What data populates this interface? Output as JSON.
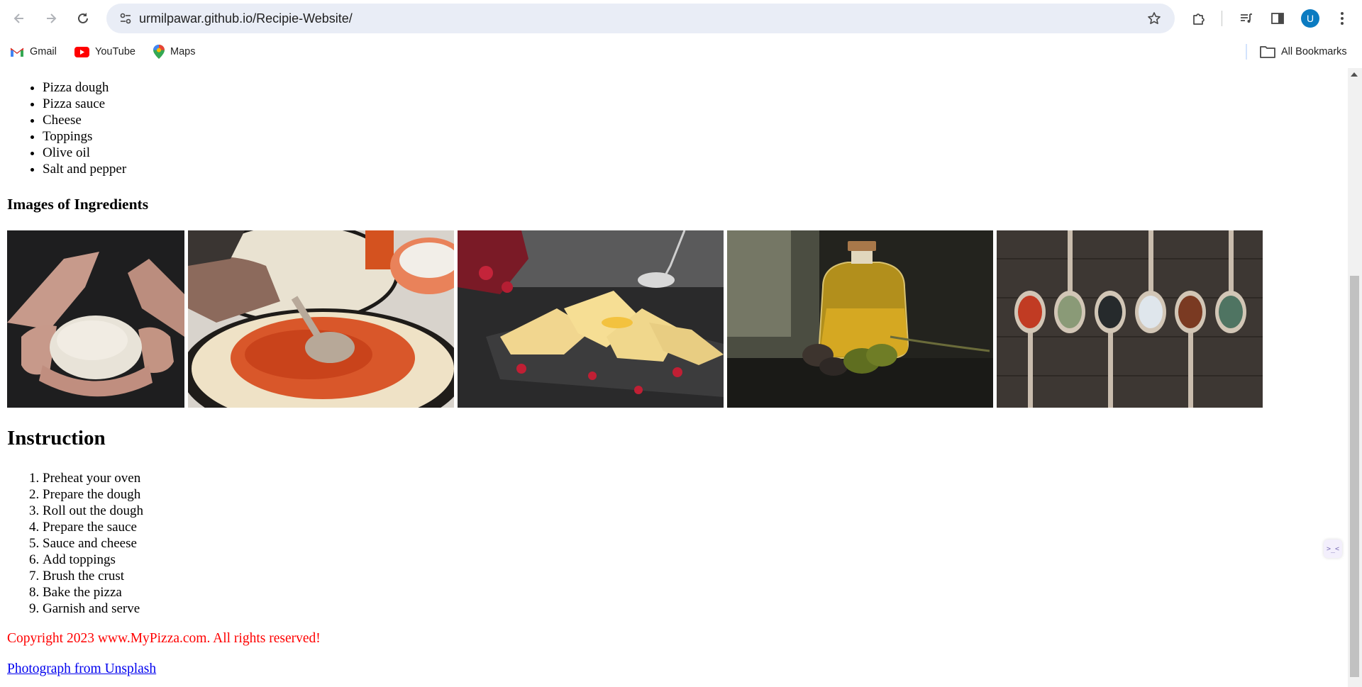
{
  "browser": {
    "url": "urmilpawar.github.io/Recipie-Website/",
    "avatar_letter": "U",
    "accent_color": "#0b7bc1",
    "bookmarks": [
      {
        "label": "Gmail",
        "icon": "gmail-icon"
      },
      {
        "label": "YouTube",
        "icon": "youtube-icon"
      },
      {
        "label": "Maps",
        "icon": "maps-icon"
      }
    ],
    "all_bookmarks_label": "All Bookmarks"
  },
  "page": {
    "ingredients": [
      "Pizza dough",
      "Pizza sauce",
      "Cheese",
      "Toppings",
      "Olive oil",
      "Salt and pepper"
    ],
    "images_heading": "Images of Ingredients",
    "images": [
      {
        "name": "pizza-dough-photo"
      },
      {
        "name": "pizza-sauce-photo"
      },
      {
        "name": "cheese-photo"
      },
      {
        "name": "olive-oil-photo"
      },
      {
        "name": "spices-photo"
      }
    ],
    "instruction_heading": "Instruction",
    "steps": [
      "Preheat your oven",
      "Prepare the dough",
      "Roll out the dough",
      "Prepare the sauce",
      "Sauce and cheese",
      "Add toppings",
      "Brush the crust",
      "Bake the pizza",
      "Garnish and serve"
    ],
    "copyright": "Copyright 2023 www.MyPizza.com. All rights reserved!",
    "copyright_color": "#ff0000",
    "credit_link": "Photograph from Unsplash",
    "link_color": "#0000ee"
  }
}
